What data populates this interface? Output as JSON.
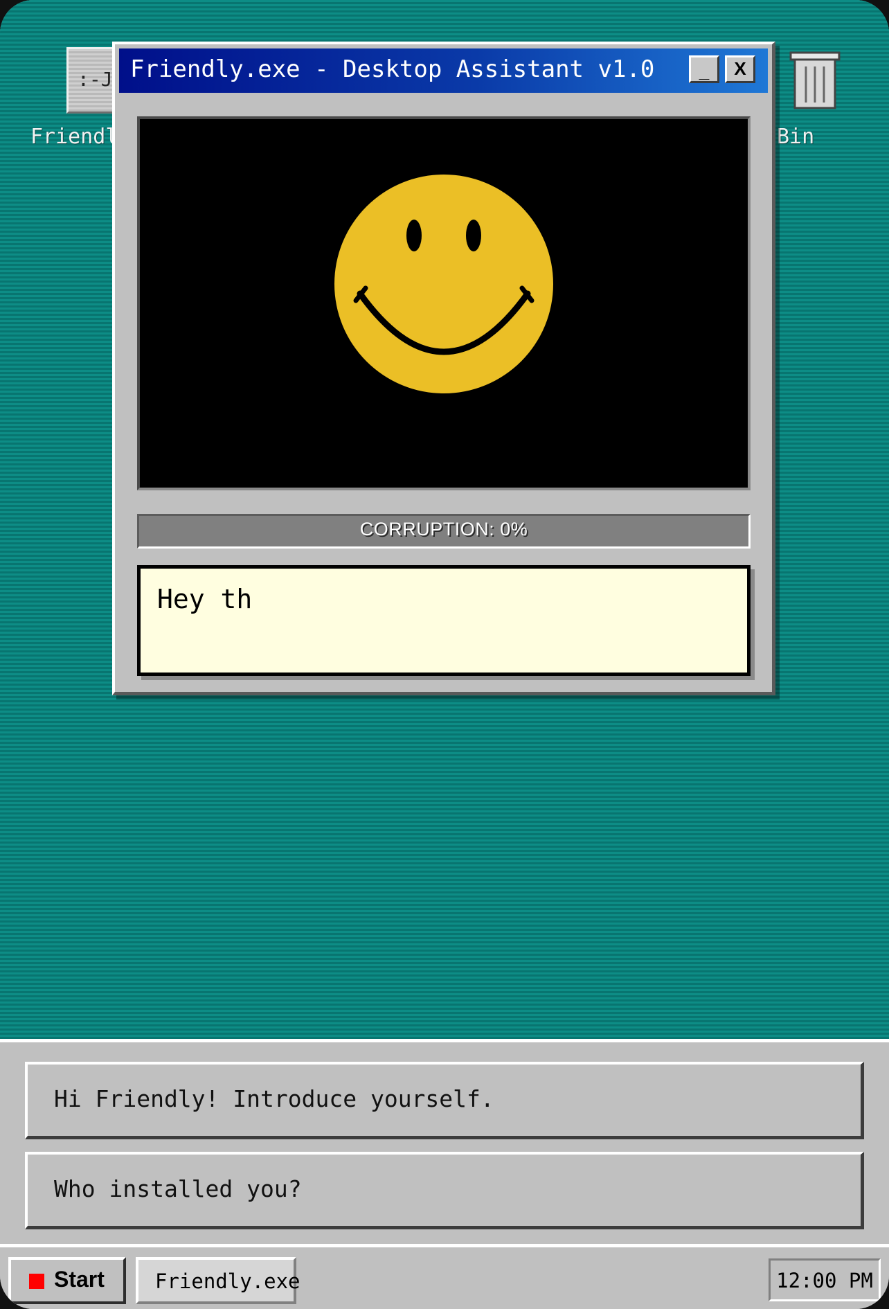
{
  "desktop": {
    "icons": [
      {
        "glyph": ":-J",
        "label": "Friendl",
        "icon": "friendly-exe-icon"
      },
      {
        "label": "Bin",
        "icon": "recycle-bin-icon"
      }
    ]
  },
  "window": {
    "title": "Friendly.exe - Desktop Assistant v1.0",
    "minimize_label": "_",
    "close_label": "X",
    "avatar": {
      "icon": "smiley-face-icon",
      "face_color": "#ebbf26",
      "background_color": "#000000"
    },
    "corruption": {
      "label": "CORRUPTION: 0%",
      "level": 0,
      "fill_color": "#c00000"
    },
    "speech_text": "Hey th"
  },
  "choices": [
    {
      "label": "Hi Friendly! Introduce yourself."
    },
    {
      "label": "Who installed you?"
    }
  ],
  "taskbar": {
    "start_label": "Start",
    "start_icon_color": "#ff0000",
    "task_label": "Friendly.exe",
    "clock": "12:00 PM"
  },
  "colors": {
    "desktop": "#0a8a83",
    "titlebar_start": "#000f8a",
    "titlebar_end": "#1f78d6",
    "chrome": "#c0c0c0",
    "speech_bg": "#fffee0"
  }
}
